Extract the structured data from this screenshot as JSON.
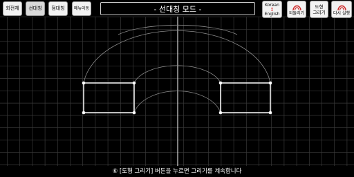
{
  "toolbar": {
    "rotation_btn": "회전체",
    "line_sym_btn": "선대칭",
    "point_sym_btn": "점대칭",
    "menu_btn": "메뉴이동"
  },
  "mode_title": "- 선대칭 모드 -",
  "lang_btn": {
    "top": "Korean",
    "arrow": "↕",
    "bottom": "English"
  },
  "undo_btn": {
    "label": "되돌리기",
    "icon": "undo-arc-icon"
  },
  "draw_btn": {
    "line1": "도형",
    "line2": "그리기"
  },
  "redo_btn": {
    "label": "다시 실행",
    "icon": "redo-arc-icon"
  },
  "status_text": "⑥ [도형 그리기] 버튼을 누르면 그리기를 계속합니다",
  "colors": {
    "background": "#000000",
    "grid": "#3a3a3a",
    "axis": "#ffffff",
    "shape": "#ffffff",
    "orbit": "#8a8a8a",
    "icon_accent": "#cc2222"
  }
}
